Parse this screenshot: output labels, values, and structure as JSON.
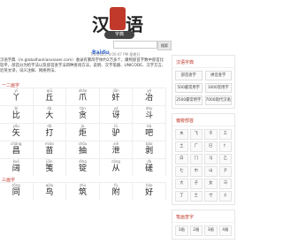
{
  "logo": {
    "char1": "汉",
    "char2": "语",
    "subtitle": "字典"
  },
  "search": {
    "engine": "Baidu",
    "button": "搜索"
  },
  "date_text": "7/6/2025, 8:00:47 PM 星期日",
  "intro": "汉语字典（m.globalhanlianxiaoer.com）收录有繁简字体约2万多个，康熙部首字数中部首比较平，部首分为检字法以及部首查字法四种查询方法，说明、汉字笔顺、UNICODE、汉字方言、近英文译，词义注解、网络用法、",
  "main": {
    "sections": [
      {
        "title": "一二画字",
        "rows": [
          [
            {
              "py": "yī",
              "hz": "丫"
            },
            {
              "py": "qiū",
              "hz": "丘"
            },
            {
              "py": "zhǎo",
              "hz": "爪"
            },
            {
              "py": "jiān",
              "hz": "奸"
            },
            {
              "py": "yě",
              "hz": "冶"
            }
          ],
          [
            {
              "py": "bǐ",
              "hz": "比"
            },
            {
              "py": "dà",
              "hz": "大"
            },
            {
              "py": "tán",
              "hz": "贪"
            },
            {
              "py": "yá",
              "hz": "讶"
            },
            {
              "py": "dòu",
              "hz": "斗"
            }
          ],
          [
            {
              "py": "yǒu",
              "hz": "矢"
            },
            {
              "py": "dǎ",
              "hz": "打"
            },
            {
              "py": "jù",
              "hz": "炬"
            },
            {
              "py": "lǜ",
              "hz": "驴"
            },
            {
              "py": "bà",
              "hz": "吧"
            }
          ],
          [
            {
              "py": "chāng",
              "hz": "昌"
            },
            {
              "py": "miáo",
              "hz": "苗"
            },
            {
              "py": "chōu",
              "hz": "抽"
            },
            {
              "py": "xiè",
              "hz": "泄"
            },
            {
              "py": "bāo",
              "hz": "剥"
            }
          ],
          [
            {
              "py": "kuò",
              "hz": "阔"
            },
            {
              "py": "jiān",
              "hz": "笺"
            },
            {
              "py": "dìng",
              "hz": "锭"
            },
            {
              "py": "cóng",
              "hz": "从"
            },
            {
              "py": "dà",
              "hz": "磋"
            }
          ]
        ]
      },
      {
        "title": "三画字",
        "rows": [
          [
            {
              "py": "tōng",
              "hz": "同"
            },
            {
              "py": "qiǎo",
              "hz": "鸟"
            },
            {
              "py": "zhù",
              "hz": "筑"
            },
            {
              "py": "fù",
              "hz": "附"
            },
            {
              "py": "hǎo",
              "hz": "好"
            }
          ]
        ]
      }
    ]
  },
  "sidebar": {
    "panels": [
      {
        "title": "汉语字典",
        "type": "buttons",
        "items": [
          "部首查字",
          "拼音查字",
          "500最常用字",
          "1000常用字",
          "2500最常用字",
          "7000现代汉语通用字"
        ]
      },
      {
        "title": "偏旁部首",
        "type": "radicals",
        "items": [
          "木",
          "飞",
          "干",
          "工",
          "土",
          "广",
          "巳",
          "忄",
          "白",
          "门",
          "马",
          "乙",
          "七",
          "巾",
          "山",
          "夕",
          "大",
          "子",
          "女",
          "彐",
          "丁",
          "士",
          "寸",
          "彡"
        ]
      },
      {
        "title": "笔画查字",
        "type": "radicals",
        "items": [
          "1画",
          "2画",
          "3画",
          "4画"
        ]
      }
    ]
  }
}
